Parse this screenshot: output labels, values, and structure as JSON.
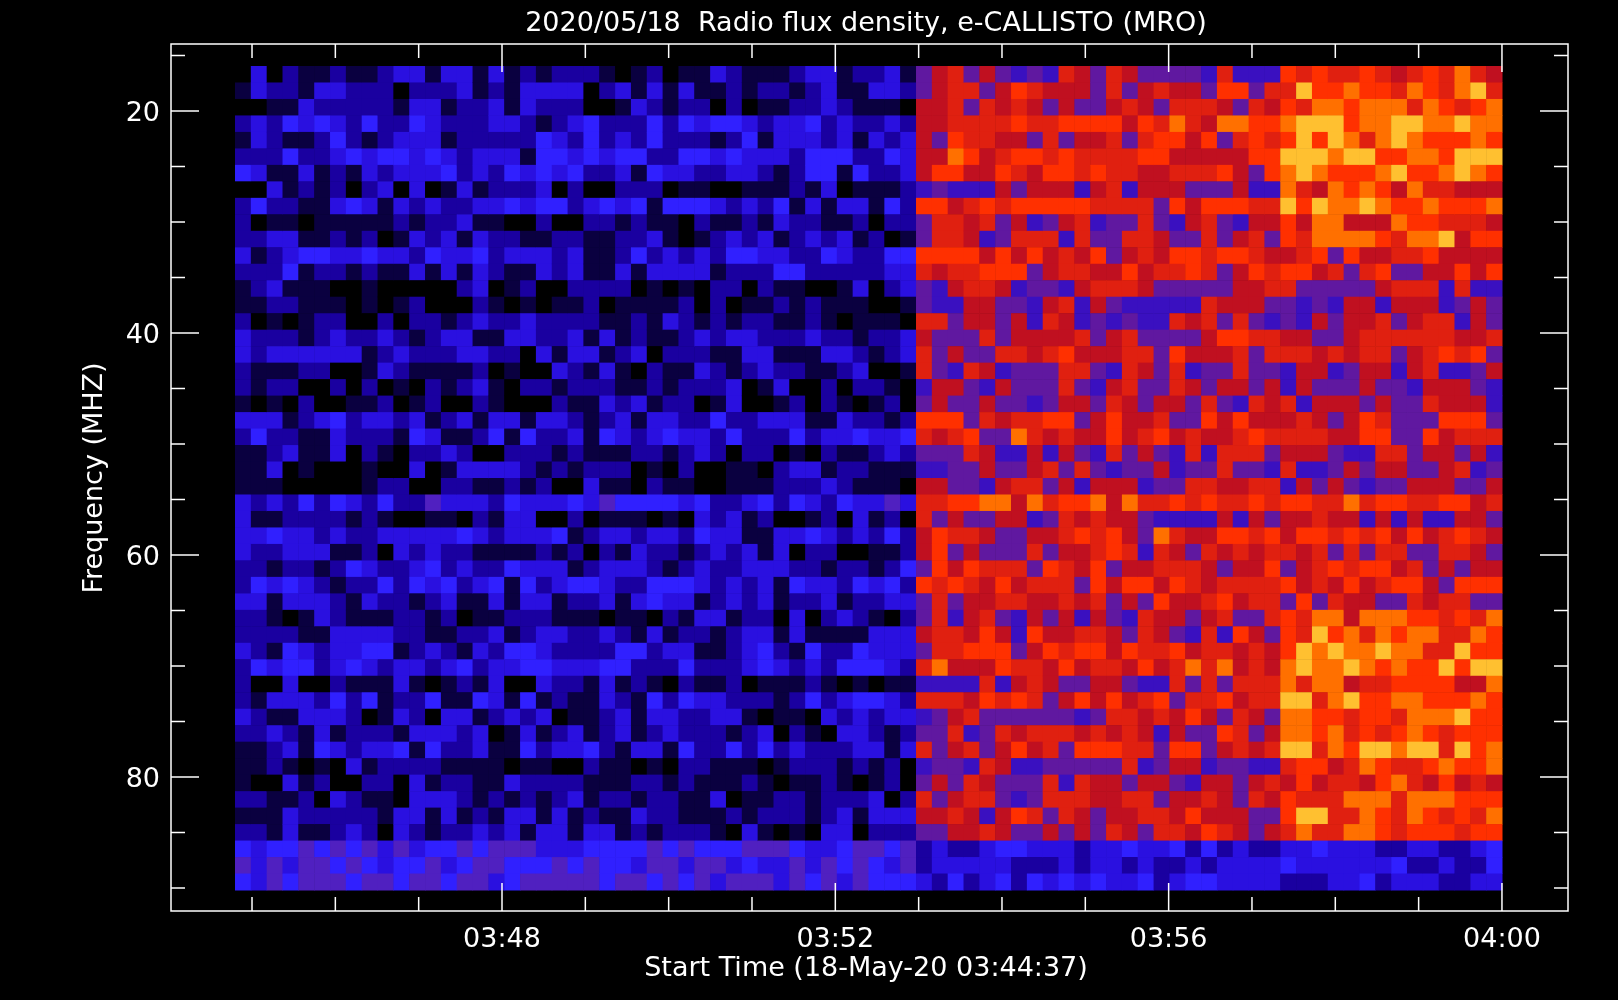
{
  "title": "2020/05/18  Radio flux density, e-CALLISTO (MRO)",
  "y_axis": {
    "label": "Frequency (MHZ)",
    "ticks": [
      "20",
      "40",
      "60",
      "80"
    ]
  },
  "x_axis": {
    "label": "Start Time (18-May-20 03:44:37)",
    "ticks": [
      "03:48",
      "03:52",
      "03:56",
      "04:00"
    ]
  }
}
